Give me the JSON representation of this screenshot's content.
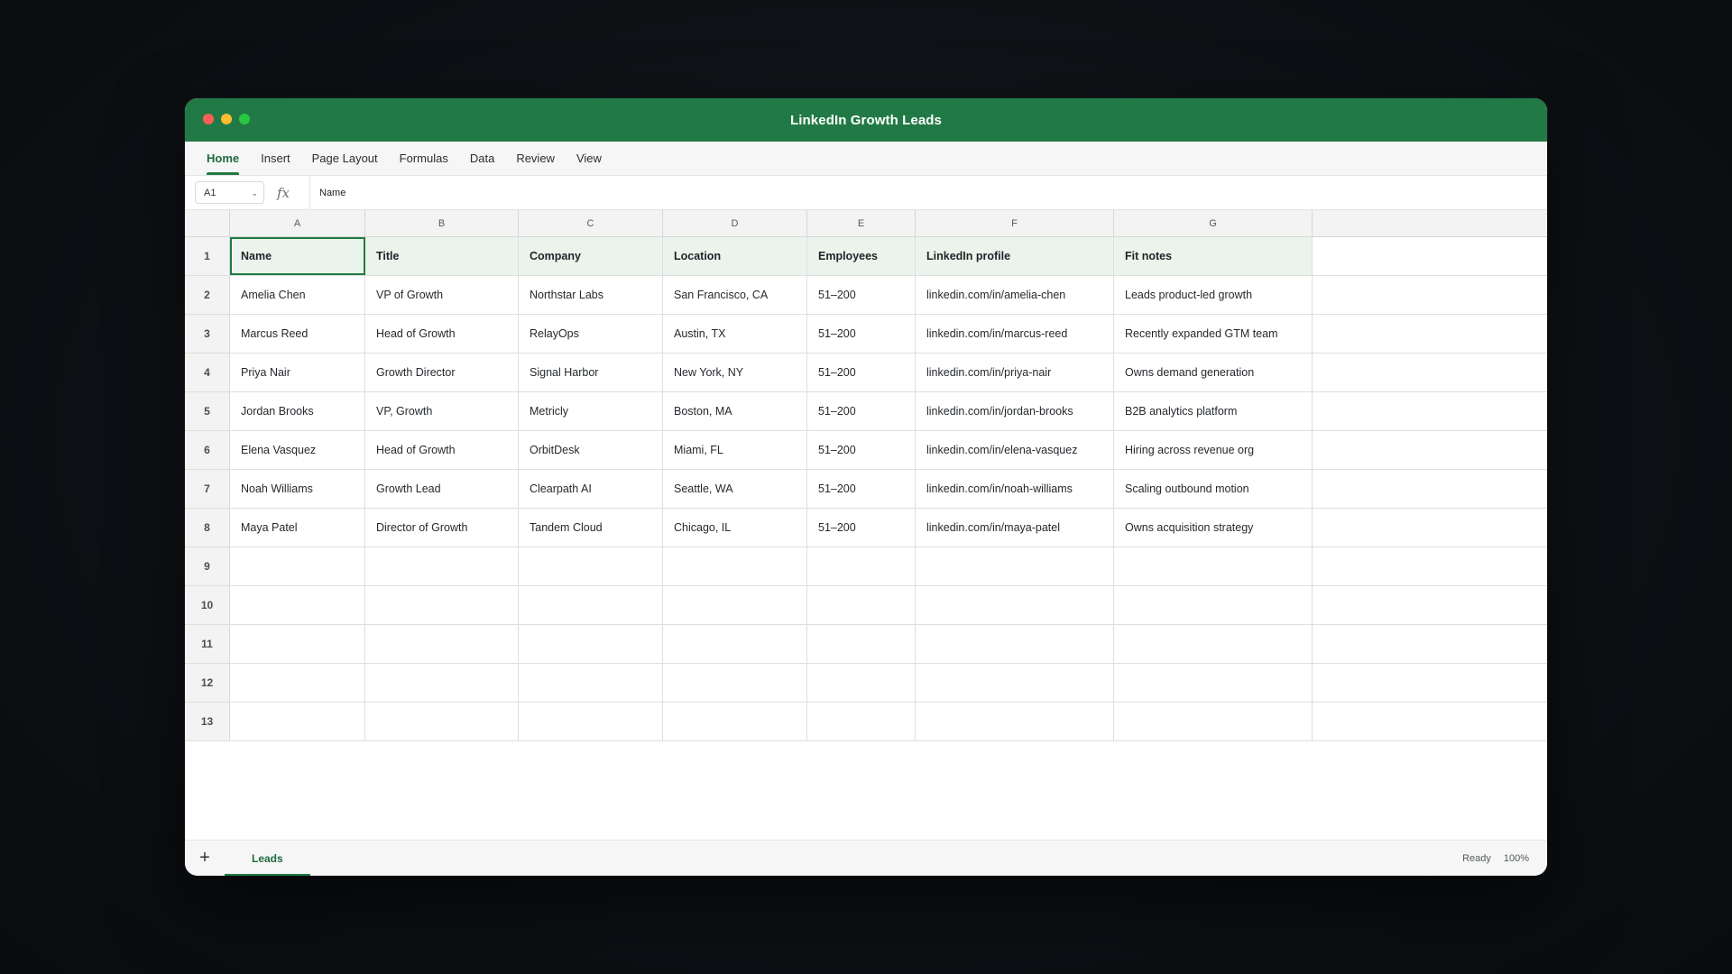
{
  "window": {
    "title": "LinkedIn Growth Leads"
  },
  "ribbon": {
    "tabs": [
      {
        "label": "Home",
        "active": true
      },
      {
        "label": "Insert"
      },
      {
        "label": "Page Layout"
      },
      {
        "label": "Formulas"
      },
      {
        "label": "Data"
      },
      {
        "label": "Review"
      },
      {
        "label": "View"
      }
    ]
  },
  "formula_bar": {
    "cell_ref": "A1",
    "fx_label": "fx",
    "value": "Name"
  },
  "sheet": {
    "column_letters": [
      "A",
      "B",
      "C",
      "D",
      "E",
      "F",
      "G"
    ],
    "row_numbers": [
      "1",
      "2",
      "3",
      "4",
      "5",
      "6",
      "7",
      "8",
      "9",
      "10",
      "11",
      "12",
      "13"
    ],
    "headers": [
      "Name",
      "Title",
      "Company",
      "Location",
      "Employees",
      "LinkedIn profile",
      "Fit notes"
    ],
    "rows": [
      [
        "Amelia Chen",
        "VP of Growth",
        "Northstar Labs",
        "San Francisco, CA",
        "51–200",
        "linkedin.com/in/amelia-chen",
        "Leads product-led growth"
      ],
      [
        "Marcus Reed",
        "Head of Growth",
        "RelayOps",
        "Austin, TX",
        "51–200",
        "linkedin.com/in/marcus-reed",
        "Recently expanded GTM team"
      ],
      [
        "Priya Nair",
        "Growth Director",
        "Signal Harbor",
        "New York, NY",
        "51–200",
        "linkedin.com/in/priya-nair",
        "Owns demand generation"
      ],
      [
        "Jordan Brooks",
        "VP, Growth",
        "Metricly",
        "Boston, MA",
        "51–200",
        "linkedin.com/in/jordan-brooks",
        "B2B analytics platform"
      ],
      [
        "Elena Vasquez",
        "Head of Growth",
        "OrbitDesk",
        "Miami, FL",
        "51–200",
        "linkedin.com/in/elena-vasquez",
        "Hiring across revenue org"
      ],
      [
        "Noah Williams",
        "Growth Lead",
        "Clearpath AI",
        "Seattle, WA",
        "51–200",
        "linkedin.com/in/noah-williams",
        "Scaling outbound motion"
      ],
      [
        "Maya Patel",
        "Director of Growth",
        "Tandem Cloud",
        "Chicago, IL",
        "51–200",
        "linkedin.com/in/maya-patel",
        "Owns acquisition strategy"
      ]
    ],
    "selected_cell": "A1"
  },
  "footer": {
    "add_sheet": "+",
    "sheet_tabs": [
      "Leads"
    ],
    "status": "Ready",
    "zoom": "100%"
  },
  "colors": {
    "accent": "#217a45",
    "header_fill": "#eaf4ec"
  }
}
